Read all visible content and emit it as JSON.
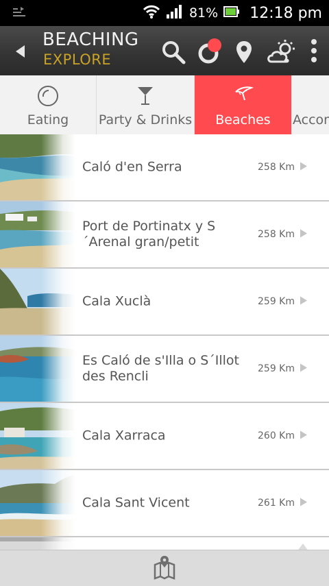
{
  "status_bar": {
    "battery_percent": "81%",
    "time": "12:18 pm"
  },
  "header": {
    "title": "BEACHING",
    "subtitle": "EXPLORE",
    "accent_color": "#c9a227",
    "icons": [
      "back-icon",
      "search-icon",
      "notifications-icon",
      "location-icon",
      "weather-icon",
      "more-icon"
    ]
  },
  "tabs": [
    {
      "label": "Eating",
      "icon": "plate-icon",
      "active": false
    },
    {
      "label": "Party & Drinks",
      "icon": "cocktail-icon",
      "active": false
    },
    {
      "label": "Beaches",
      "icon": "umbrella-icon",
      "active": true
    },
    {
      "label": "Accommodation",
      "icon": "",
      "active": false
    }
  ],
  "tab_active_color": "#ff4b4f",
  "beaches": [
    {
      "name": "Caló d'en Serra",
      "distance": "258 Km"
    },
    {
      "name": "Port de Portinatx y S ´Arenal gran/petit",
      "distance": "258 Km"
    },
    {
      "name": "Cala Xuclà",
      "distance": "259 Km"
    },
    {
      "name": "Es Caló de s'Illa o S´Illot des Rencli",
      "distance": "259 Km"
    },
    {
      "name": "Cala Xarraca",
      "distance": "260 Km"
    },
    {
      "name": "Cala Sant Vicent",
      "distance": "261 Km"
    }
  ],
  "bottom_bar": {
    "icon": "map-icon"
  }
}
